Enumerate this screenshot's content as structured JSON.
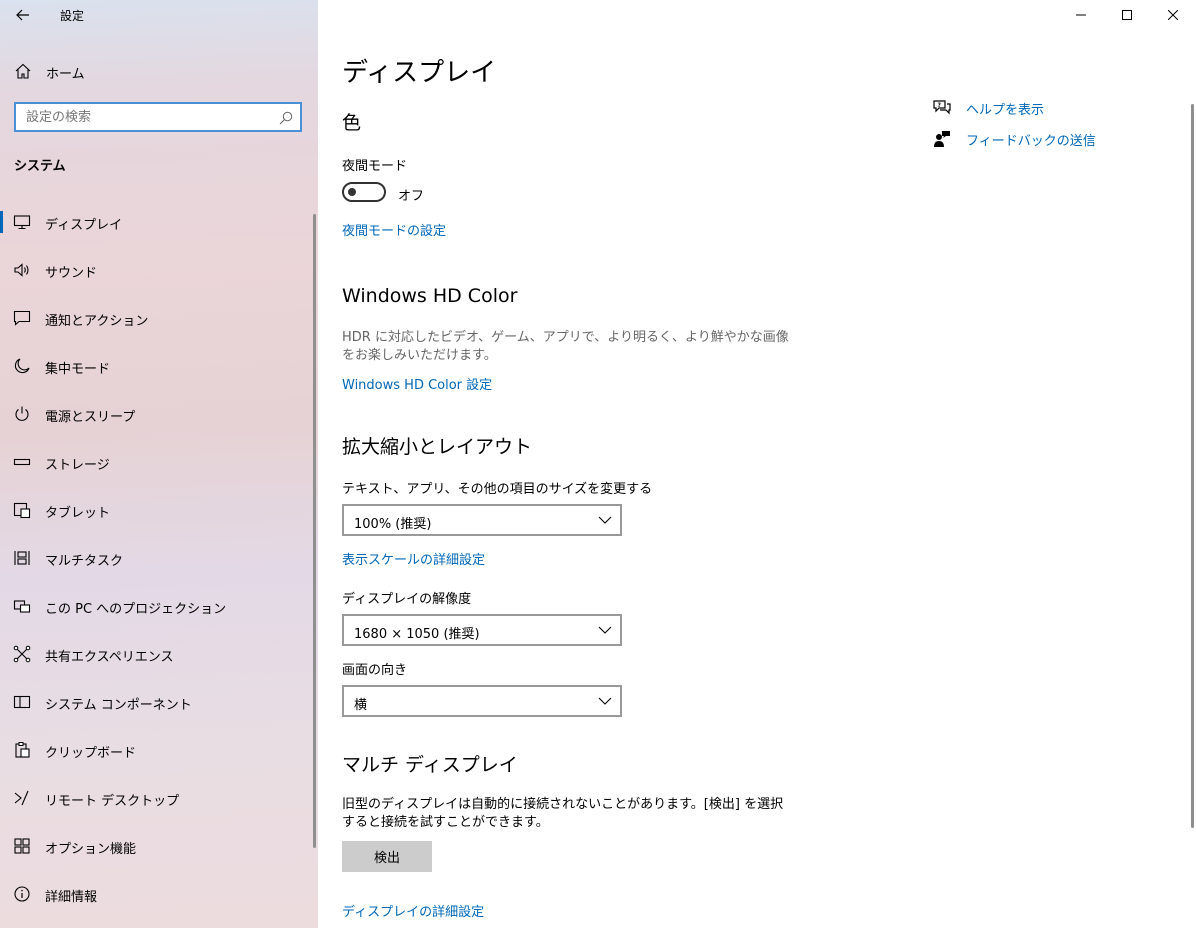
{
  "window": {
    "title": "設定"
  },
  "sidebar": {
    "home_label": "ホーム",
    "search_placeholder": "設定の検索",
    "section": "システム",
    "items": [
      {
        "label": "ディスプレイ",
        "icon": "monitor-icon"
      },
      {
        "label": "サウンド",
        "icon": "speaker-icon"
      },
      {
        "label": "通知とアクション",
        "icon": "message-icon"
      },
      {
        "label": "集中モード",
        "icon": "moon-icon"
      },
      {
        "label": "電源とスリープ",
        "icon": "power-icon"
      },
      {
        "label": "ストレージ",
        "icon": "storage-icon"
      },
      {
        "label": "タブレット",
        "icon": "tablet-icon"
      },
      {
        "label": "マルチタスク",
        "icon": "multitask-icon"
      },
      {
        "label": "この PC へのプロジェクション",
        "icon": "projection-icon"
      },
      {
        "label": "共有エクスペリエンス",
        "icon": "share-icon"
      },
      {
        "label": "システム コンポーネント",
        "icon": "component-icon"
      },
      {
        "label": "クリップボード",
        "icon": "clipboard-icon"
      },
      {
        "label": "リモート デスクトップ",
        "icon": "remote-icon"
      },
      {
        "label": "オプション機能",
        "icon": "grid-icon"
      },
      {
        "label": "詳細情報",
        "icon": "info-icon"
      }
    ]
  },
  "main": {
    "title": "ディスプレイ",
    "color": {
      "heading": "色",
      "night_label": "夜間モード",
      "night_state": "オフ",
      "night_link": "夜間モードの設定"
    },
    "hdr": {
      "heading": "Windows HD Color",
      "desc": "HDR に対応したビデオ、ゲーム、アプリで、より明るく、より鮮やかな画像をお楽しみいただけます。",
      "link": "Windows HD Color 設定"
    },
    "scale": {
      "heading": "拡大縮小とレイアウト",
      "size_label": "テキスト、アプリ、その他の項目のサイズを変更する",
      "size_value": "100% (推奨)",
      "scale_link": "表示スケールの詳細設定",
      "res_label": "ディスプレイの解像度",
      "res_value": "1680 × 1050 (推奨)",
      "orient_label": "画面の向き",
      "orient_value": "横"
    },
    "multi": {
      "heading": "マルチ ディスプレイ",
      "desc": "旧型のディスプレイは自動的に接続されないことがあります。[検出] を選択すると接続を試すことができます。",
      "detect_button": "検出",
      "advanced_link": "ディスプレイの詳細設定"
    },
    "help": {
      "help_label": "ヘルプを表示",
      "feedback_label": "フィードバックの送信"
    }
  },
  "colors": {
    "accent": "#0067b8"
  }
}
